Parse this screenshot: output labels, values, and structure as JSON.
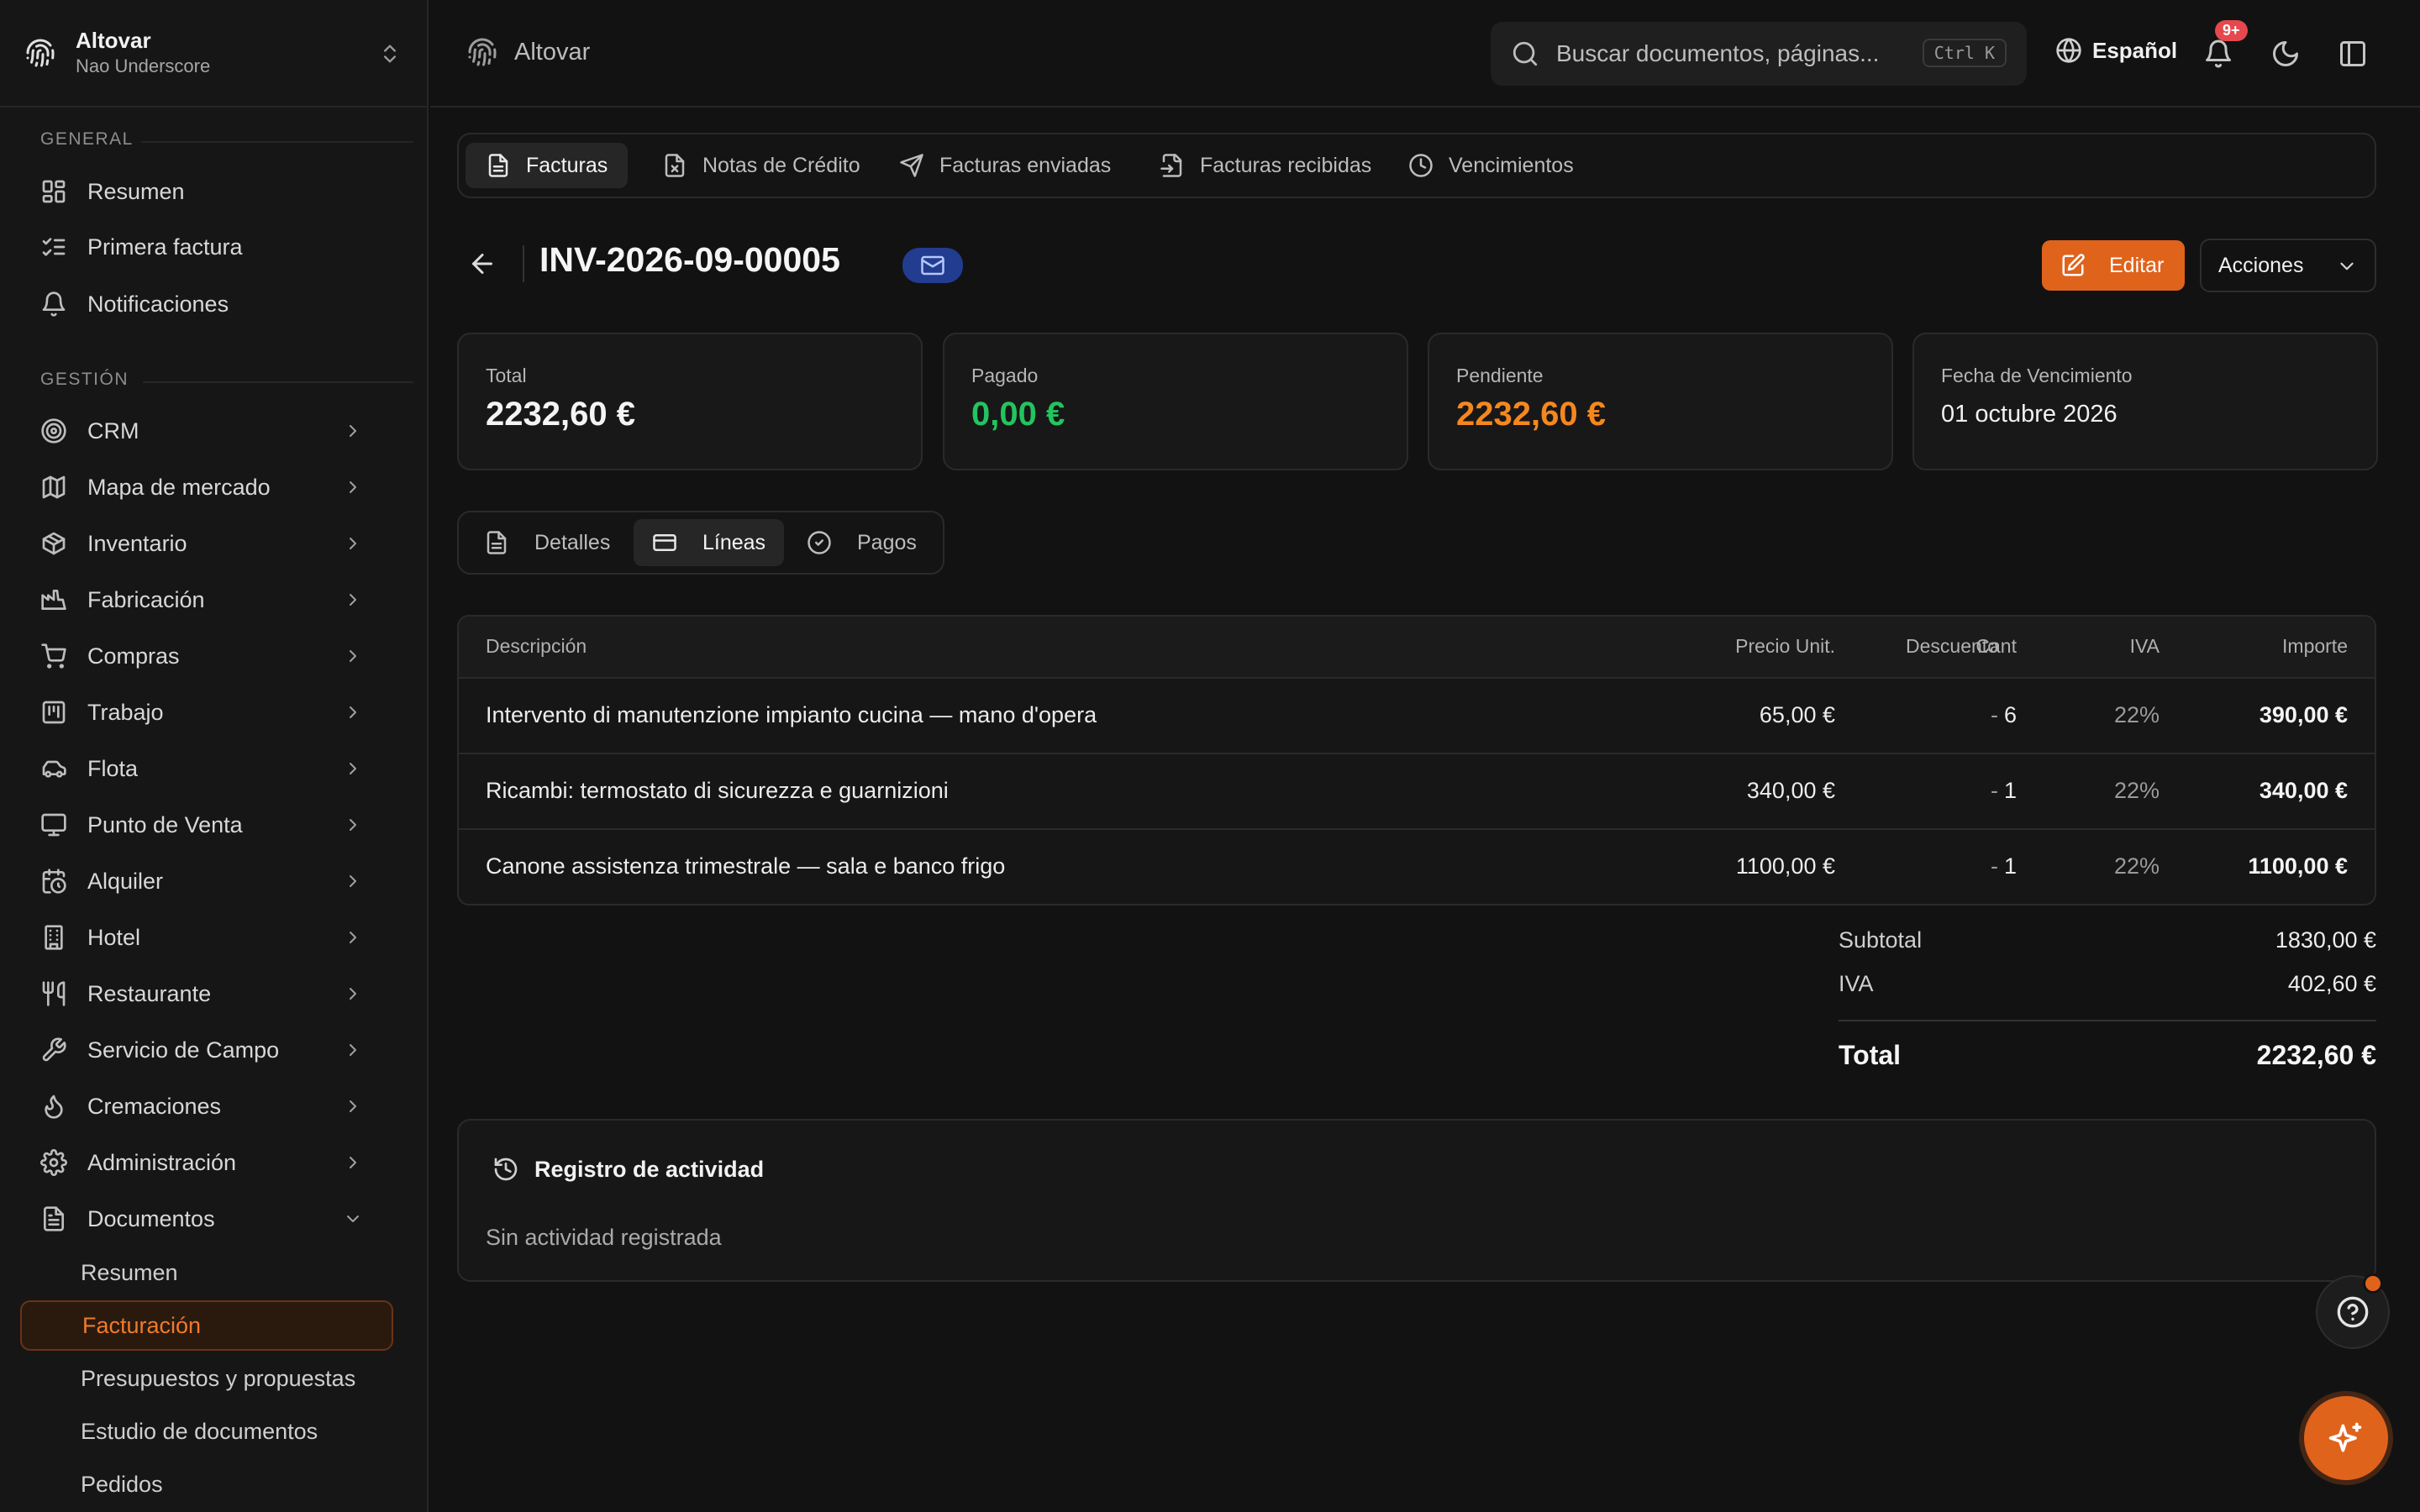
{
  "workspace": {
    "org": "Altovar",
    "user": "Nao Underscore"
  },
  "sidebar": {
    "section_general": "GENERAL",
    "general_items": [
      {
        "label": "Resumen",
        "icon": "dashboard-icon"
      },
      {
        "label": "Primera factura",
        "icon": "checklist-icon"
      },
      {
        "label": "Notificaciones",
        "icon": "bell-icon"
      }
    ],
    "section_management": "GESTIÓN",
    "management_items": [
      {
        "label": "CRM",
        "icon": "target-icon"
      },
      {
        "label": "Mapa de mercado",
        "icon": "map-icon"
      },
      {
        "label": "Inventario",
        "icon": "box-icon"
      },
      {
        "label": "Fabricación",
        "icon": "factory-icon"
      },
      {
        "label": "Compras",
        "icon": "cart-icon"
      },
      {
        "label": "Trabajo",
        "icon": "kanban-icon"
      },
      {
        "label": "Flota",
        "icon": "car-icon"
      },
      {
        "label": "Punto de Venta",
        "icon": "monitor-icon"
      },
      {
        "label": "Alquiler",
        "icon": "calendar-clock-icon"
      },
      {
        "label": "Hotel",
        "icon": "building-icon"
      },
      {
        "label": "Restaurante",
        "icon": "utensils-icon"
      },
      {
        "label": "Servicio de Campo",
        "icon": "wrench-icon"
      },
      {
        "label": "Cremaciones",
        "icon": "flame-icon"
      },
      {
        "label": "Administración",
        "icon": "gear-icon"
      },
      {
        "label": "Documentos",
        "icon": "document-icon"
      }
    ],
    "document_subitems": [
      "Resumen",
      "Facturación",
      "Presupuestos y propuestas",
      "Estudio de documentos",
      "Pedidos"
    ],
    "active_subitem": "Facturación"
  },
  "topbar": {
    "brand": "Altovar",
    "search_placeholder": "Buscar documentos, páginas...",
    "search_shortcut": "Ctrl K",
    "language": "Español",
    "notification_badge": "9+"
  },
  "doc_tabs": [
    {
      "label": "Facturas",
      "active": true
    },
    {
      "label": "Notas de Crédito",
      "active": false
    },
    {
      "label": "Facturas enviadas",
      "active": false
    },
    {
      "label": "Facturas recibidas",
      "active": false
    },
    {
      "label": "Vencimientos",
      "active": false
    }
  ],
  "invoice": {
    "number": "INV-2026-09-00005",
    "edit_label": "Editar",
    "actions_label": "Acciones"
  },
  "stats": {
    "total_label": "Total",
    "total_value": "2232,60 €",
    "paid_label": "Pagado",
    "paid_value": "0,00 €",
    "pending_label": "Pendiente",
    "pending_value": "2232,60 €",
    "due_label": "Fecha de Vencimiento",
    "due_value": "01 octubre 2026"
  },
  "line_tabs": [
    {
      "label": "Detalles",
      "active": false
    },
    {
      "label": "Líneas",
      "active": true
    },
    {
      "label": "Pagos",
      "active": false
    }
  ],
  "table": {
    "headers": [
      "Descripción",
      "Cant",
      "Precio Unit.",
      "Descuento",
      "IVA",
      "Importe"
    ],
    "rows": [
      [
        "Intervento di manutenzione impianto cucina — mano d'opera",
        "6",
        "65,00 €",
        "-",
        "22%",
        "390,00 €"
      ],
      [
        "Ricambi: termostato di sicurezza e guarnizioni",
        "1",
        "340,00 €",
        "-",
        "22%",
        "340,00 €"
      ],
      [
        "Canone assistenza trimestrale — sala e banco frigo",
        "1",
        "1100,00 €",
        "-",
        "22%",
        "1100,00 €"
      ]
    ]
  },
  "totals": {
    "subtotal_label": "Subtotal",
    "subtotal_value": "1830,00 €",
    "vat_label": "IVA",
    "vat_value": "402,60 €",
    "total_label": "Total",
    "total_value": "2232,60 €"
  },
  "activity": {
    "title": "Registro de actividad",
    "empty": "Sin actividad registrada"
  },
  "colors": {
    "accent": "#e0631c",
    "paid": "#22c55e",
    "pending": "#f5871f",
    "badge": "#e5484d",
    "mail_badge": "#223c8f"
  }
}
